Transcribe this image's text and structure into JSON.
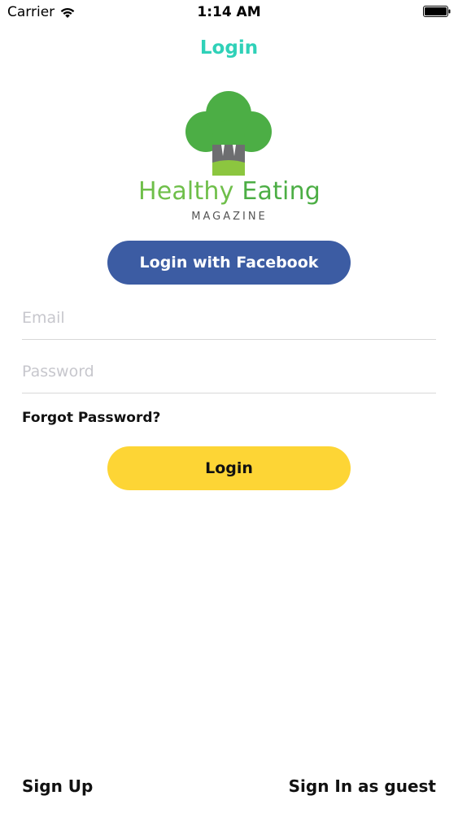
{
  "status_bar": {
    "carrier": "Carrier",
    "time": "1:14 AM"
  },
  "nav": {
    "title": "Login"
  },
  "logo": {
    "title_part1": "Healthy",
    "title_part2": "Eating",
    "subtitle": "MAGAZINE"
  },
  "buttons": {
    "facebook_label": "Login with Facebook",
    "login_label": "Login"
  },
  "form": {
    "email_placeholder": "Email",
    "password_placeholder": "Password",
    "email_value": "",
    "password_value": ""
  },
  "links": {
    "forgot_password": "Forgot Password?",
    "sign_up": "Sign Up",
    "sign_in_guest": "Sign In as guest"
  },
  "colors": {
    "title_teal": "#2fd1b8",
    "facebook_blue": "#3c5ca3",
    "login_yellow": "#fdd535",
    "logo_green": "#6fbf4a"
  },
  "icons": {
    "wifi": "wifi-icon",
    "battery": "battery-icon",
    "logo": "broccoli-chef-icon"
  }
}
